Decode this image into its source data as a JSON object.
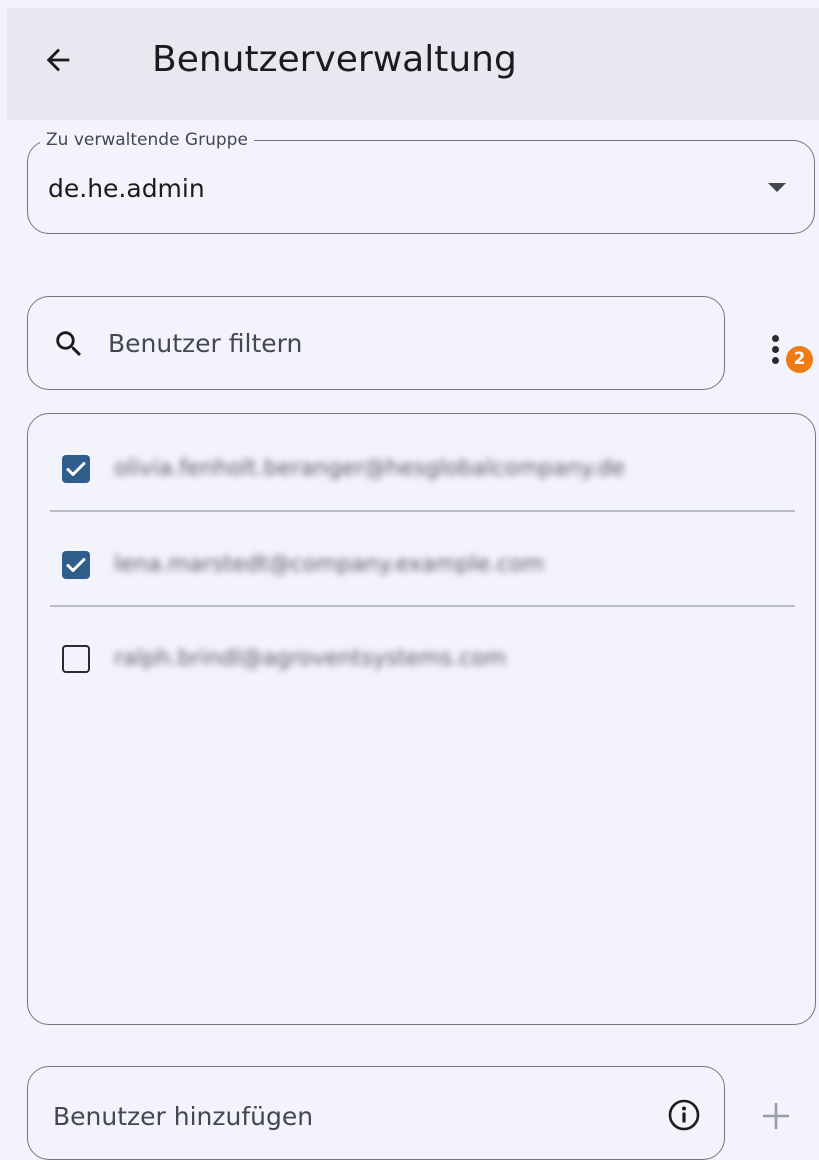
{
  "appbar": {
    "title": "Benutzerverwaltung",
    "back_icon": "arrow-back-icon"
  },
  "group_select": {
    "label": "Zu verwaltende Gruppe",
    "value": "de.he.admin",
    "dropdown_icon": "arrow-drop-down-icon"
  },
  "filter": {
    "placeholder": "Benutzer filtern",
    "search_icon": "search-icon",
    "more_icon": "more-vert-icon",
    "badge_count": "2"
  },
  "users": [
    {
      "checked": true,
      "email": "olivia.fenholt.beranger@hesglobalcompany.de"
    },
    {
      "checked": true,
      "email": "lena.marstedt@company.example.com"
    },
    {
      "checked": false,
      "email": "ralph.brindl@agroventsystems.com"
    }
  ],
  "add_user": {
    "placeholder": "Benutzer hinzufügen",
    "info_icon": "info-icon",
    "add_icon": "add-icon"
  },
  "colors": {
    "background": "#f3f3fb",
    "appbar": "#e8e8f0",
    "checkbox_checked": "#2f5d8c",
    "badge": "#ef7b15",
    "outline": "#74777f"
  }
}
